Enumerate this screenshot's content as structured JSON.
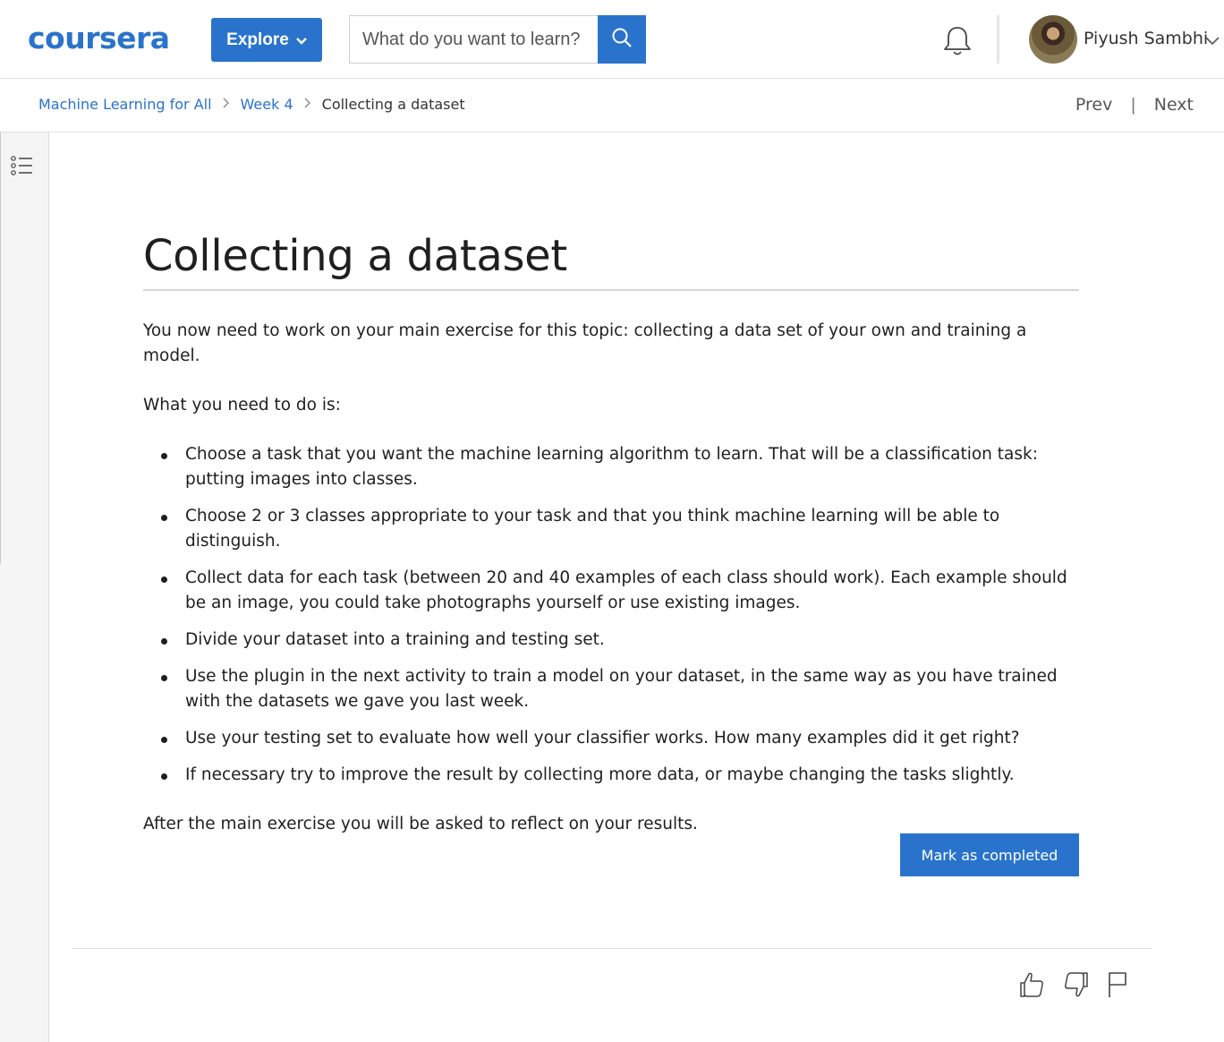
{
  "header": {
    "logo_text": "coursera",
    "explore_label": "Explore",
    "search_placeholder": "What do you want to learn?",
    "user_name": "Piyush Sambhi"
  },
  "breadcrumb": {
    "items": [
      "Machine Learning for All",
      "Week 4"
    ],
    "current": "Collecting a dataset",
    "prev_label": "Prev",
    "next_label": "Next",
    "divider": "|"
  },
  "content": {
    "title": "Collecting a dataset",
    "intro": "You now need to work on your main exercise for this topic: collecting a data set of your own and training a model.",
    "lead": "What you need to do is:",
    "steps": [
      "Choose a task that you want the machine learning algorithm to learn. That will be a classification task: putting images into classes.",
      "Choose 2 or 3 classes appropriate to your task and that you think machine learning will be able to distinguish.",
      "Collect data for each task (between 20 and 40 examples of each class should work). Each example should be an image, you could take photographs yourself or use existing images.",
      "Divide your dataset into a training and testing set.",
      "Use the plugin in the next activity to train a model on your dataset, in the same way as you have trained with the datasets we gave you last week.",
      "Use your testing set to evaluate how well your classifier works. How many examples did it get right?",
      "If necessary try to improve the result by collecting more data, or maybe changing the tasks slightly."
    ],
    "outro": "After the main exercise you will be asked to reflect on your results.",
    "complete_label": "Mark as completed"
  },
  "icons": {
    "search": "search-icon",
    "bell": "bell-icon",
    "rail": "list-icon",
    "like": "thumbs-up-icon",
    "dislike": "thumbs-down-icon",
    "flag": "flag-icon"
  },
  "colors": {
    "brand": "#2a73cc"
  }
}
